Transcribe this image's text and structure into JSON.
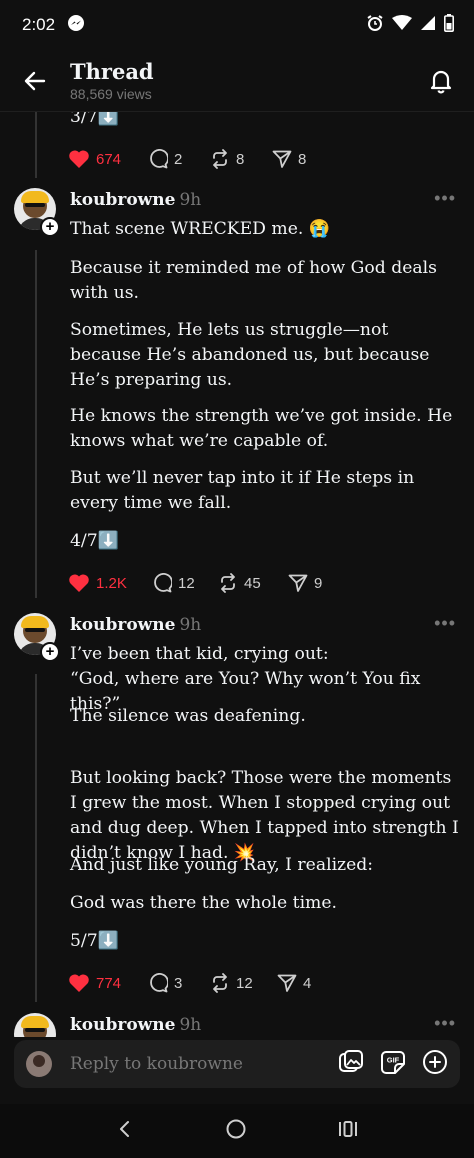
{
  "status_bar": {
    "time": "2:02"
  },
  "header": {
    "title": "Thread",
    "views": "88,569 views"
  },
  "reply_bar": {
    "placeholder": "Reply to koubrowne",
    "gif_label": "GIF"
  },
  "top_post": {
    "marker": "3/7⬇️",
    "likes": "674",
    "replies": "2",
    "reposts": "8",
    "shares": "8"
  },
  "posts": [
    {
      "username": "koubrowne",
      "time_ago": "9h",
      "paragraphs": [
        "That scene WRECKED me. 😭",
        "Because it reminded me of how God deals with us.",
        "Sometimes, He lets us struggle—not because He’s abandoned us, but because He’s preparing us.",
        "He knows the strength we’ve got inside. He knows what we’re capable of.",
        "But we’ll never tap into it if He steps in every time we fall.",
        "4/7⬇️"
      ],
      "likes": "1.2K",
      "replies": "12",
      "reposts": "45",
      "shares": "9"
    },
    {
      "username": "koubrowne",
      "time_ago": "9h",
      "paragraphs": [
        "I’ve been that kid, crying out:\n“God, where are You? Why won’t You fix this?”",
        "The silence was deafening.",
        "But looking back? Those were the moments I grew the most. When I stopped crying out and dug deep. When I tapped into strength I didn’t know I had. 💥",
        "And just like young Ray, I realized:",
        "God was there the whole time.",
        "5/7⬇️"
      ],
      "likes": "774",
      "replies": "3",
      "reposts": "12",
      "shares": "4"
    },
    {
      "username": "koubrowne",
      "time_ago": "9h"
    }
  ]
}
